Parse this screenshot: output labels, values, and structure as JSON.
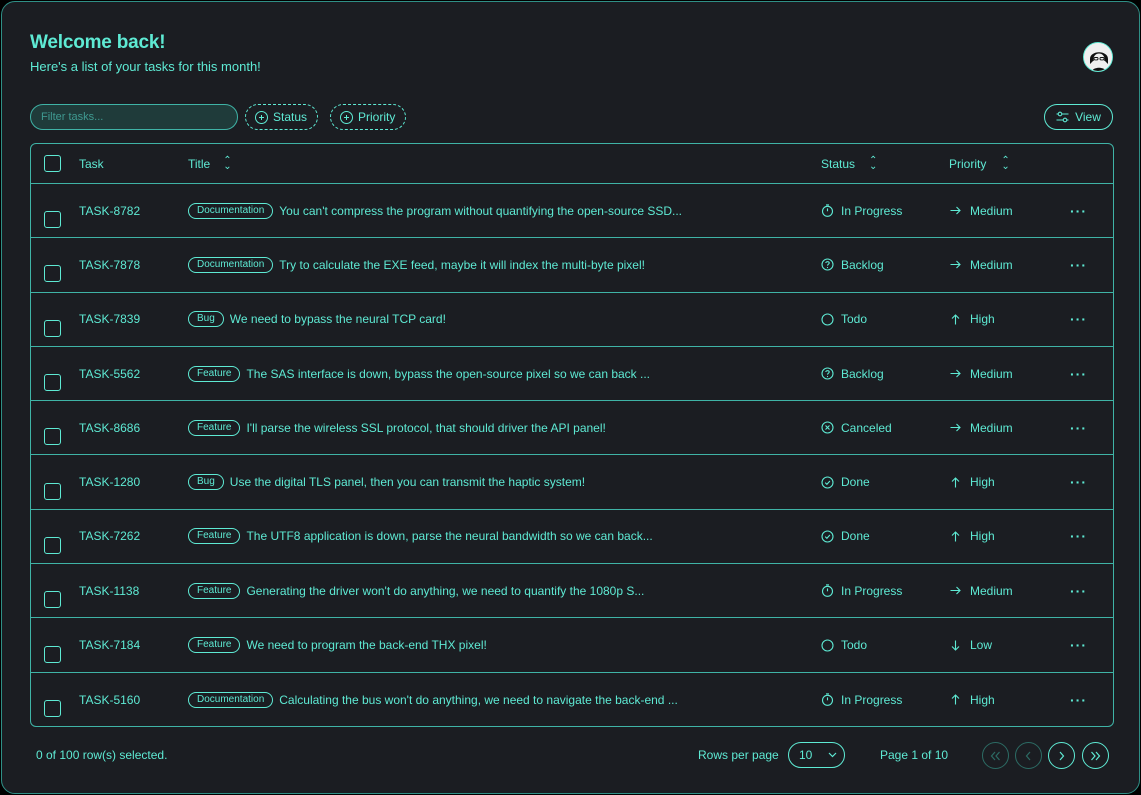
{
  "header": {
    "title": "Welcome back!",
    "subtitle": "Here's a list of your tasks for this month!"
  },
  "toolbar": {
    "filter_placeholder": "Filter tasks...",
    "status_label": "Status",
    "priority_label": "Priority",
    "view_label": "View"
  },
  "table": {
    "columns": {
      "task": "Task",
      "title": "Title",
      "status": "Status",
      "priority": "Priority"
    },
    "rows": [
      {
        "id": "TASK-8782",
        "label": "Documentation",
        "title": "You can't compress the program without quantifying the open-source SSD...",
        "status": "In Progress",
        "status_icon": "timer-icon",
        "priority": "Medium",
        "priority_icon": "arrow-right-icon"
      },
      {
        "id": "TASK-7878",
        "label": "Documentation",
        "title": "Try to calculate the EXE feed, maybe it will index the multi-byte pixel!",
        "status": "Backlog",
        "status_icon": "help-circle-icon",
        "priority": "Medium",
        "priority_icon": "arrow-right-icon"
      },
      {
        "id": "TASK-7839",
        "label": "Bug",
        "title": "We need to bypass the neural TCP card!",
        "status": "Todo",
        "status_icon": "circle-icon",
        "priority": "High",
        "priority_icon": "arrow-up-icon"
      },
      {
        "id": "TASK-5562",
        "label": "Feature",
        "title": "The SAS interface is down, bypass the open-source pixel so we can back ...",
        "status": "Backlog",
        "status_icon": "help-circle-icon",
        "priority": "Medium",
        "priority_icon": "arrow-right-icon"
      },
      {
        "id": "TASK-8686",
        "label": "Feature",
        "title": "I'll parse the wireless SSL protocol, that should driver the API panel!",
        "status": "Canceled",
        "status_icon": "x-circle-icon",
        "priority": "Medium",
        "priority_icon": "arrow-right-icon"
      },
      {
        "id": "TASK-1280",
        "label": "Bug",
        "title": "Use the digital TLS panel, then you can transmit the haptic system!",
        "status": "Done",
        "status_icon": "check-circle-icon",
        "priority": "High",
        "priority_icon": "arrow-up-icon"
      },
      {
        "id": "TASK-7262",
        "label": "Feature",
        "title": "The UTF8 application is down, parse the neural bandwidth so we can back...",
        "status": "Done",
        "status_icon": "check-circle-icon",
        "priority": "High",
        "priority_icon": "arrow-up-icon"
      },
      {
        "id": "TASK-1138",
        "label": "Feature",
        "title": "Generating the driver won't do anything, we need to quantify the 1080p S...",
        "status": "In Progress",
        "status_icon": "timer-icon",
        "priority": "Medium",
        "priority_icon": "arrow-right-icon"
      },
      {
        "id": "TASK-7184",
        "label": "Feature",
        "title": "We need to program the back-end THX pixel!",
        "status": "Todo",
        "status_icon": "circle-icon",
        "priority": "Low",
        "priority_icon": "arrow-down-icon"
      },
      {
        "id": "TASK-5160",
        "label": "Documentation",
        "title": "Calculating the bus won't do anything, we need to navigate the back-end ...",
        "status": "In Progress",
        "status_icon": "timer-icon",
        "priority": "High",
        "priority_icon": "arrow-up-icon"
      }
    ]
  },
  "footer": {
    "selected_text": "0 of 100 row(s) selected.",
    "rows_per_page_label": "Rows per page",
    "rows_per_page_value": "10",
    "page_info": "Page 1 of 10"
  },
  "colors": {
    "accent": "#5eead4",
    "background": "#1b1d22",
    "border": "#3fb3a6"
  }
}
